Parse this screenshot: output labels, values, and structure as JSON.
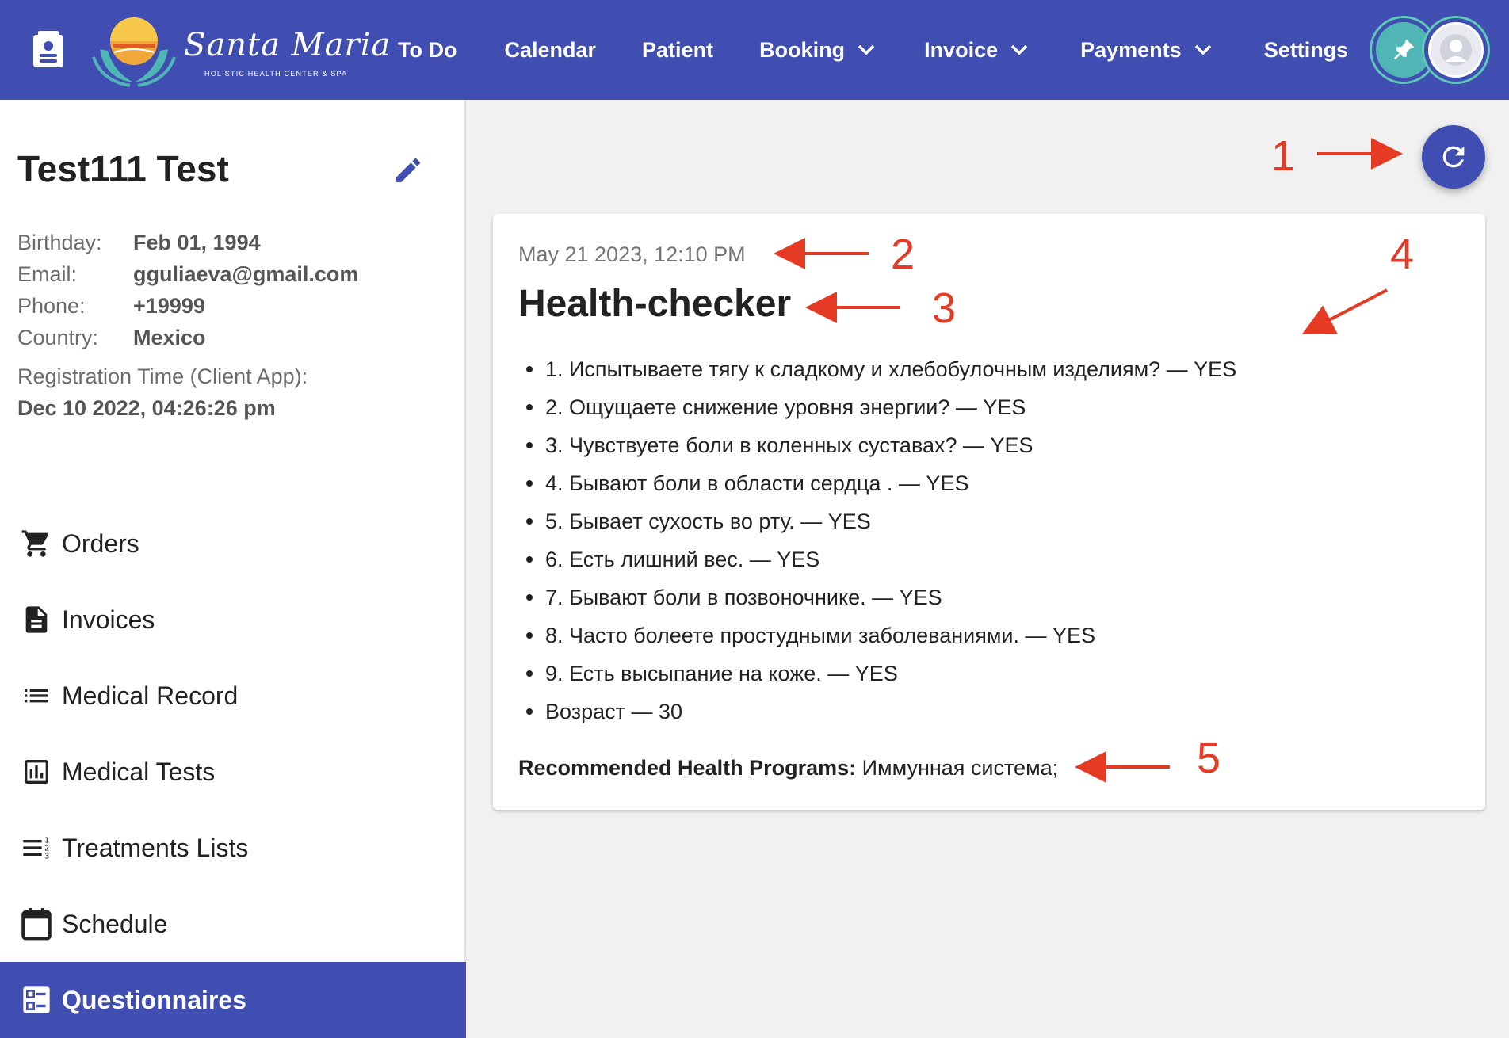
{
  "header": {
    "logo_title": "Santa Maria",
    "logo_subtitle": "HOLISTIC HEALTH CENTER & SPA",
    "nav": [
      {
        "label": "To Do",
        "dropdown": false
      },
      {
        "label": "Calendar",
        "dropdown": false
      },
      {
        "label": "Patient",
        "dropdown": false
      },
      {
        "label": "Booking",
        "dropdown": true
      },
      {
        "label": "Invoice",
        "dropdown": true
      },
      {
        "label": "Payments",
        "dropdown": true
      },
      {
        "label": "Settings",
        "dropdown": false
      }
    ],
    "icons": [
      "contact-card-icon",
      "pin-icon",
      "avatar"
    ]
  },
  "patient": {
    "name": "Test111 Test",
    "fields": [
      {
        "label": "Birthday:",
        "value": "Feb 01, 1994"
      },
      {
        "label": "Email:",
        "value": "gguliaeva@gmail.com"
      },
      {
        "label": "Phone:",
        "value": "+19999"
      },
      {
        "label": "Country:",
        "value": "Mexico"
      }
    ],
    "registration_label": "Registration Time (Client App):",
    "registration_value": "Dec 10 2022, 04:26:26 pm"
  },
  "sidebar_menu": [
    {
      "label": "Orders",
      "icon": "cart-icon",
      "active": false
    },
    {
      "label": "Invoices",
      "icon": "document-icon",
      "active": false
    },
    {
      "label": "Medical Record",
      "icon": "list-icon",
      "active": false
    },
    {
      "label": "Medical Tests",
      "icon": "chart-box-icon",
      "active": false
    },
    {
      "label": "Treatments Lists",
      "icon": "numbered-list-icon",
      "active": false
    },
    {
      "label": "Schedule",
      "icon": "calendar-icon",
      "active": false
    },
    {
      "label": "Questionnaires",
      "icon": "questionnaire-icon",
      "active": true
    }
  ],
  "questionnaire": {
    "date": "May 21 2023, 12:10 PM",
    "title": "Health-checker",
    "answers": [
      "1. Испытываете тягу к сладкому и хлебобулочным изделиям? — YES",
      "2. Ощущаете снижение уровня энергии? — YES",
      "3. Чувствуете боли в коленных суставах? — YES",
      "4. Бывают боли в области сердца . — YES",
      "5. Бывает сухость во рту. — YES",
      "6. Есть лишний вес. — YES",
      "7. Бывают боли в позвоночнике. — YES",
      "8. Часто болеете простудными заболеваниями. — YES",
      "9. Есть высыпание на коже. — YES",
      "Возраст — 30"
    ],
    "recommended_label": "Recommended Health Programs:",
    "recommended_value": " Иммунная система;"
  },
  "annotations": [
    "1",
    "2",
    "3",
    "4",
    "5"
  ],
  "colors": {
    "primary": "#3f4eb0",
    "annotation": "#e53a23",
    "accent_teal": "#4fb6b5"
  }
}
